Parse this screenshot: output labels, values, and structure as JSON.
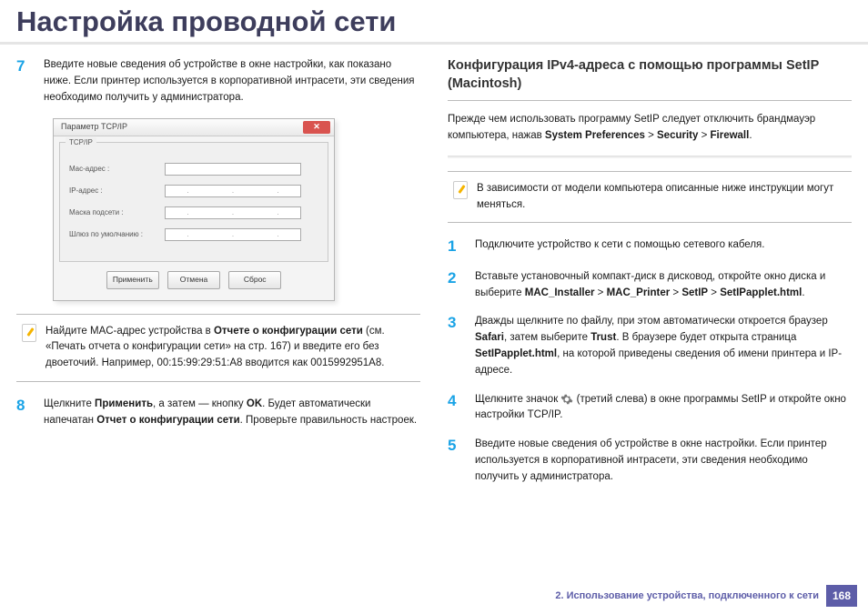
{
  "title": "Настройка проводной сети",
  "left": {
    "step7": {
      "num": "7",
      "text": "Введите новые сведения об устройстве в окне настройки, как показано ниже. Если принтер используется в корпоративной интрасети, эти сведения необходимо получить у администратора."
    },
    "dialog": {
      "title": "Параметр TCP/IP",
      "group": "TCP/IP",
      "rows": {
        "mac": "Mac-адрес :",
        "ip": "IP-адрес :",
        "mask": "Маска подсети :",
        "gw": "Шлюз по умолчанию :"
      },
      "buttons": {
        "apply": "Применить",
        "cancel": "Отмена",
        "reset": "Сброс"
      }
    },
    "note": {
      "pre": "Найдите MAC-адрес устройства в ",
      "bold": "Отчете о конфигурации сети",
      "post": " (см. «Печать отчета о конфигурации сети» на стр. 167) и введите его без двоеточий. Например, 00:15:99:29:51:A8 вводится как 0015992951A8."
    },
    "step8": {
      "num": "8",
      "t1": "Щелкните ",
      "b1": "Применить",
      "t2": ", а затем — кнопку ",
      "b2": "OK",
      "t3": ". Будет автоматически напечатан ",
      "b3": "Отчет о конфигурации сети",
      "t4": ". Проверьте правильность настроек."
    }
  },
  "right": {
    "section": "Конфигурация IPv4-адреса с помощью программы SetIP (Macintosh)",
    "intro": {
      "t1": "Прежде чем использовать программу SetIP следует отключить брандмауэр компьютера, нажав ",
      "b1": "System Preferences",
      "sep": " > ",
      "b2": "Security",
      "b3": "Firewall",
      "dot": "."
    },
    "note": "В зависимости от модели компьютера описанные ниже инструкции могут меняться.",
    "steps": {
      "s1": {
        "num": "1",
        "text": "Подключите устройство к сети с помощью сетевого кабеля."
      },
      "s2": {
        "num": "2",
        "t1": "Вставьте установочный компакт-диск в дисковод, откройте окно диска и выберите ",
        "b1": "MAC_Installer",
        "b2": "MAC_Printer",
        "b3": "SetIP",
        "b4": "SetIPapplet.html",
        "dot": "."
      },
      "s3": {
        "num": "3",
        "t1": "Дважды щелкните по файлу, при этом автоматически откроется браузер ",
        "b1": "Safari",
        "t2": ", затем выберите ",
        "b2": "Trust",
        "t3": ". В браузере будет открыта страница ",
        "b3": "SetIPapplet.html",
        "t4": ", на которой приведены сведения об имени принтера и IP-адресе."
      },
      "s4": {
        "num": "4",
        "t1": "Щелкните значок",
        "t2": "(третий слева) в окне программы SetIP и откройте окно настройки TCP/IP."
      },
      "s5": {
        "num": "5",
        "text": "Введите новые сведения об устройстве в окне настройки. Если принтер используется в корпоративной интрасети, эти сведения необходимо получить у администратора."
      }
    }
  },
  "footer": {
    "chapter": "2.  Использование устройства, подключенного к сети",
    "page": "168"
  }
}
